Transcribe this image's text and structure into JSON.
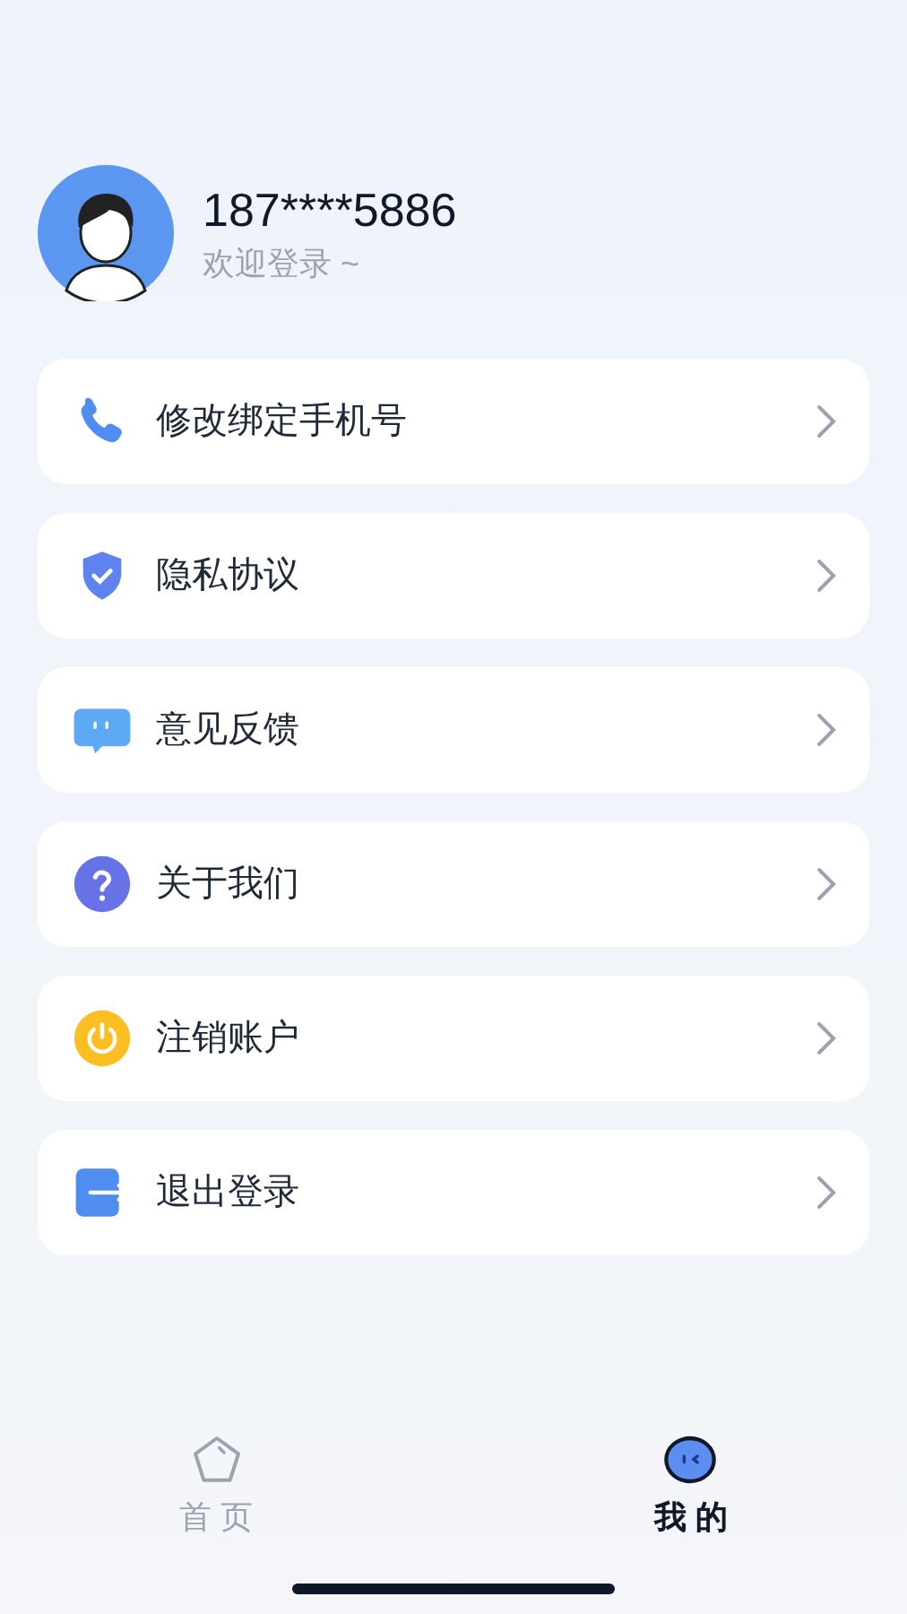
{
  "profile": {
    "phone": "187****5886",
    "subtitle": "欢迎登录 ~"
  },
  "menu": [
    {
      "kind": "phone",
      "label": "修改绑定手机号"
    },
    {
      "kind": "shield",
      "label": "隐私协议"
    },
    {
      "kind": "chat",
      "label": "意见反馈"
    },
    {
      "kind": "help",
      "label": "关于我们"
    },
    {
      "kind": "power",
      "label": "注销账户"
    },
    {
      "kind": "logout",
      "label": "退出登录"
    }
  ],
  "tabs": [
    {
      "kind": "home",
      "label": "首 页",
      "selected": false
    },
    {
      "kind": "me",
      "label": "我 的",
      "selected": true
    }
  ]
}
